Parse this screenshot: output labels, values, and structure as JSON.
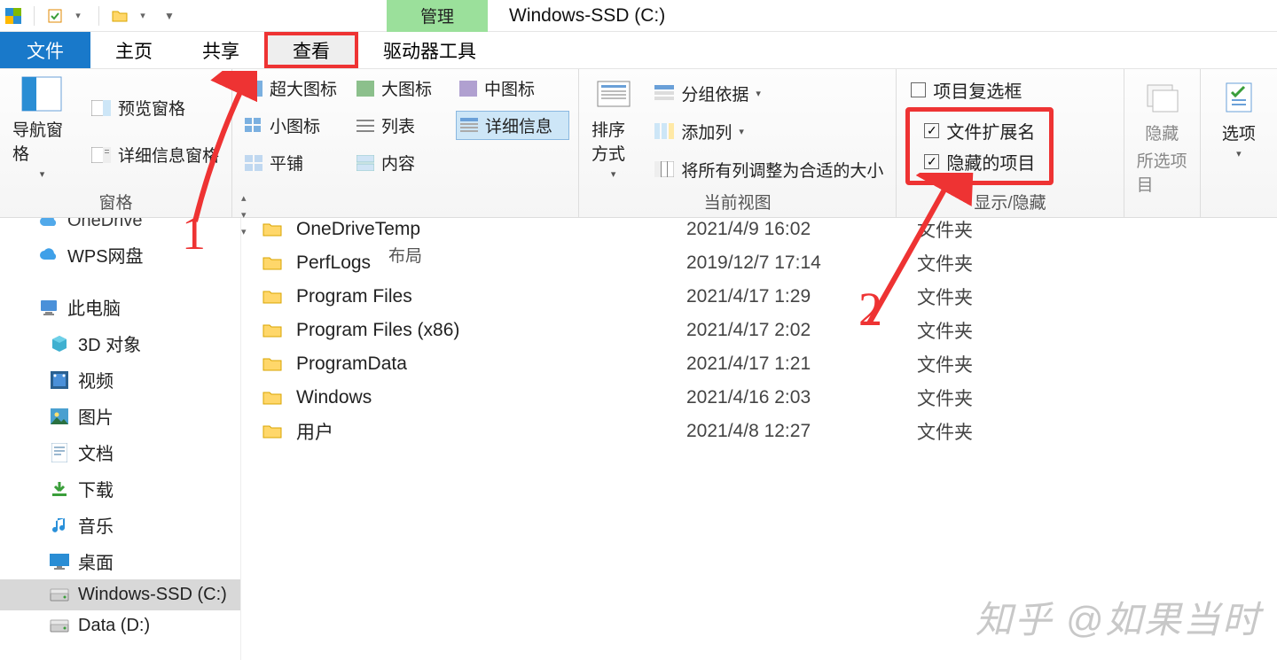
{
  "window_title": "Windows-SSD (C:)",
  "context_tab": "管理",
  "tabs": {
    "file": "文件",
    "home": "主页",
    "share": "共享",
    "view": "查看",
    "drive_tools": "驱动器工具"
  },
  "ribbon": {
    "group_panes": {
      "nav_pane": "导航窗格",
      "preview_pane": "预览窗格",
      "details_pane": "详细信息窗格",
      "label": "窗格"
    },
    "group_layout": {
      "xl_icons": "超大图标",
      "l_icons": "大图标",
      "m_icons": "中图标",
      "s_icons": "小图标",
      "list": "列表",
      "details": "详细信息",
      "tiles": "平铺",
      "content": "内容",
      "label": "布局"
    },
    "group_currentview": {
      "sort_by": "排序方式",
      "group_by": "分组依据",
      "add_columns": "添加列",
      "size_all": "将所有列调整为合适的大小",
      "label": "当前视图"
    },
    "group_showhide": {
      "item_checkboxes": "项目复选框",
      "file_ext": "文件扩展名",
      "hidden_items": "隐藏的项目",
      "hide_selected_a": "隐藏",
      "hide_selected_b": "所选项目",
      "label": "显示/隐藏"
    },
    "group_options": {
      "label": "选项"
    }
  },
  "tree": [
    {
      "icon": "cloud",
      "label": "OneDrive",
      "indent": 0
    },
    {
      "icon": "cloud",
      "label": "WPS网盘",
      "indent": 0
    },
    {
      "icon": "pc",
      "label": "此电脑",
      "indent": 0
    },
    {
      "icon": "cube",
      "label": "3D 对象",
      "indent": 1
    },
    {
      "icon": "video",
      "label": "视频",
      "indent": 1
    },
    {
      "icon": "pictures",
      "label": "图片",
      "indent": 1
    },
    {
      "icon": "docs",
      "label": "文档",
      "indent": 1
    },
    {
      "icon": "download",
      "label": "下载",
      "indent": 1
    },
    {
      "icon": "music",
      "label": "音乐",
      "indent": 1
    },
    {
      "icon": "desktop",
      "label": "桌面",
      "indent": 1
    },
    {
      "icon": "drive",
      "label": "Windows-SSD (C:)",
      "indent": 1,
      "selected": true
    },
    {
      "icon": "drive",
      "label": "Data (D:)",
      "indent": 1
    }
  ],
  "files": [
    {
      "name": "OneDriveTemp",
      "date": "2021/4/9 16:02",
      "type": "文件夹"
    },
    {
      "name": "PerfLogs",
      "date": "2019/12/7 17:14",
      "type": "文件夹"
    },
    {
      "name": "Program Files",
      "date": "2021/4/17 1:29",
      "type": "文件夹"
    },
    {
      "name": "Program Files (x86)",
      "date": "2021/4/17 2:02",
      "type": "文件夹"
    },
    {
      "name": "ProgramData",
      "date": "2021/4/17 1:21",
      "type": "文件夹"
    },
    {
      "name": "Windows",
      "date": "2021/4/16 2:03",
      "type": "文件夹"
    },
    {
      "name": "用户",
      "date": "2021/4/8 12:27",
      "type": "文件夹"
    }
  ],
  "annotations": {
    "step1": "1",
    "step2": "2"
  },
  "watermark": "知乎 @如果当时"
}
